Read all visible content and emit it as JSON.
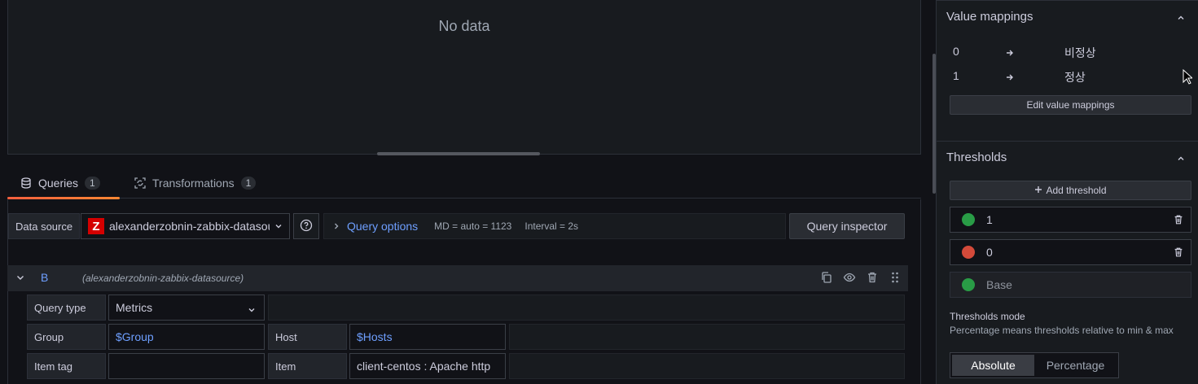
{
  "preview": {
    "no_data": "No data"
  },
  "tabs": [
    {
      "label": "Queries",
      "count": "1"
    },
    {
      "label": "Transformations",
      "count": "1"
    }
  ],
  "datasource": {
    "label": "Data source",
    "value": "alexanderzobnin-zabbix-datasource",
    "logo_letter": "Z"
  },
  "query_options": {
    "label": "Query options",
    "md": "MD = auto = 1123",
    "interval": "Interval = 2s"
  },
  "query_inspector": "Query inspector",
  "query": {
    "name": "B",
    "datasource": "(alexanderzobnin-zabbix-datasource)",
    "fields": {
      "query_type_label": "Query type",
      "query_type_value": "Metrics",
      "group_label": "Group",
      "group_value": "$Group",
      "host_label": "Host",
      "host_value": "$Hosts",
      "item_tag_label": "Item tag",
      "item_tag_value": "",
      "item_label": "Item",
      "item_value": "client-centos : Apache http"
    }
  },
  "value_mappings": {
    "title": "Value mappings",
    "rows": [
      {
        "from": "0",
        "to": "비정상"
      },
      {
        "from": "1",
        "to": "정상"
      }
    ],
    "edit_button": "Edit value mappings"
  },
  "thresholds": {
    "title": "Thresholds",
    "add_button": "Add threshold",
    "items": [
      {
        "value": "1",
        "color": "#299c46"
      },
      {
        "value": "0",
        "color": "#d44a3a"
      },
      {
        "value": "Base",
        "color": "#299c46"
      }
    ],
    "mode_title": "Thresholds mode",
    "mode_desc": "Percentage means thresholds relative to min & max",
    "modes": [
      "Absolute",
      "Percentage"
    ],
    "selected_mode": "Absolute"
  }
}
